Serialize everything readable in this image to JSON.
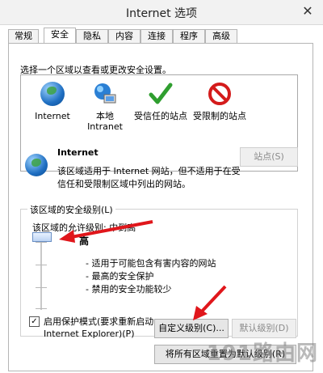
{
  "window": {
    "title": "Internet 选项",
    "close_glyph": "✕"
  },
  "tabs": [
    {
      "label": "常规"
    },
    {
      "label": "安全"
    },
    {
      "label": "隐私"
    },
    {
      "label": "内容"
    },
    {
      "label": "连接"
    },
    {
      "label": "程序"
    },
    {
      "label": "高级"
    }
  ],
  "zones": {
    "prompt": "选择一个区域以查看或更改安全设置。",
    "items": [
      {
        "label": "Internet",
        "icon": "globe-icon"
      },
      {
        "label": "本地 Intranet",
        "icon": "intranet-icon"
      },
      {
        "label": "受信任的站点",
        "icon": "checkmark-icon"
      },
      {
        "label": "受限制的站点",
        "icon": "no-entry-icon"
      }
    ]
  },
  "selected_zone": {
    "title": "Internet",
    "description": "该区域适用于 Internet 网站，但不适用于在受信任和受限制区域中列出的网站。",
    "sites_button": "站点(S)"
  },
  "security_level": {
    "group_title": "该区域的安全级别(L)",
    "allowed_levels": "该区域的允许级别: 中到高",
    "level_name": "高",
    "bullets": [
      "- 适用于可能包含有害内容的网站",
      "- 最高的安全保护",
      "- 禁用的安全功能较少"
    ],
    "slider_level_fraction": 1.0
  },
  "protected_mode": {
    "checked": true,
    "label_line1": "启用保护模式(要求重新启动",
    "label_line2": "Internet Explorer)(P)"
  },
  "buttons": {
    "custom_level": "自定义级别(C)...",
    "default_level": "默认级别(D)",
    "reset_all": "将所有区域重置为默认级别(R)"
  },
  "watermark": "191路由网",
  "colors": {
    "arrow": "#e0161b",
    "check_green": "#2f9e2f",
    "no_entry_red": "#d41b1b"
  }
}
